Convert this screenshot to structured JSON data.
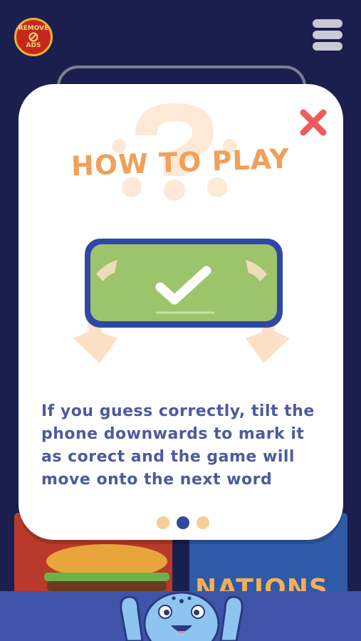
{
  "header": {
    "remove_ads_line1": "REMOVE",
    "remove_ads_line2": "ADS"
  },
  "modal": {
    "title": "HOW TO PLAY",
    "instruction": "If you guess correctly, tilt the phone downwards to mark it as corect and the game will move onto the next word",
    "pagination": {
      "total": 3,
      "active": 2
    }
  },
  "background": {
    "card_label": "NATIONS"
  },
  "colors": {
    "background": "#1a1f4e",
    "title": "#f1a05a",
    "text": "#4d5a9e",
    "close": "#ee5b5b",
    "phone_screen": "#9cc46a",
    "phone_border": "#2f47a5",
    "dot_active": "#2f4a9a",
    "dot_inactive": "#f7cd96",
    "bottom_bar": "#3f54a9"
  },
  "icons": {
    "close": "close-x-icon",
    "menu": "hamburger-menu-icon",
    "check": "checkmark-icon"
  }
}
